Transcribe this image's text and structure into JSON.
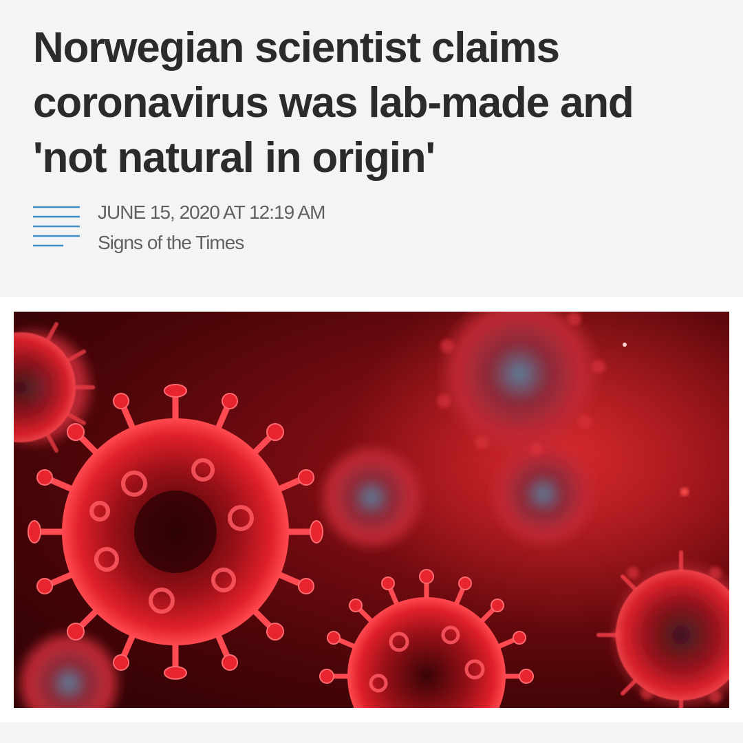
{
  "article": {
    "headline_lines": [
      "Norwegian scientist claims",
      "coronavirus was lab-made and",
      "'not natural in origin'"
    ],
    "date": "JUNE 15, 2020 AT 12:19 AM",
    "source": "Signs of the Times"
  },
  "icons": {
    "menu": "hamburger-menu-icon"
  },
  "colors": {
    "background": "#f4f4f4",
    "headline": "#2b2b2b",
    "meta_text": "#616161",
    "menu_lines": "#3f8fc4",
    "virus_red": "#e0202a",
    "image_background": "#4a0508"
  },
  "image": {
    "subject": "coronavirus-particles-illustration"
  }
}
